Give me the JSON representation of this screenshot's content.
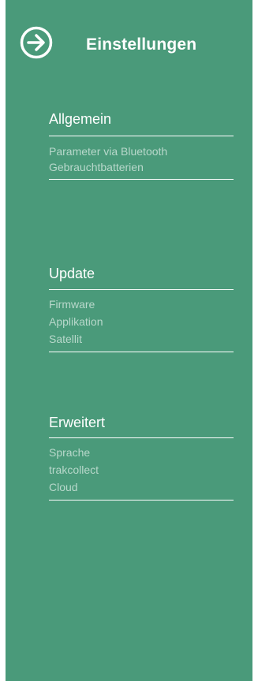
{
  "header": {
    "title": "Einstellungen",
    "back_icon": "arrow-right-circle-icon"
  },
  "colors": {
    "panel_bg": "#4a9a7a",
    "text": "#ffffff",
    "item_text": "#b8d8cb",
    "page_bg": "#ffffff"
  },
  "sections": [
    {
      "title": "Allgemein",
      "items": [
        "Parameter via Bluetooth",
        "Gebrauchtbatterien"
      ]
    },
    {
      "title": "Update",
      "items": [
        "Firmware",
        "Applikation",
        "Satellit"
      ]
    },
    {
      "title": "Erweitert",
      "items": [
        "Sprache",
        "trakcollect",
        "Cloud"
      ]
    }
  ]
}
